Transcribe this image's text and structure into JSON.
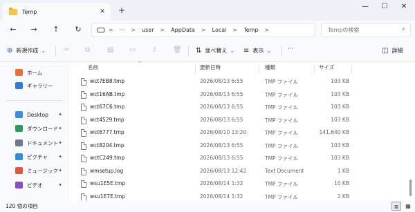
{
  "tab": {
    "title": "Temp",
    "close": "✕",
    "new_tab": "+"
  },
  "window": {
    "minimize": "—",
    "maximize": "☐",
    "close": "✕"
  },
  "nav": {
    "back": "←",
    "forward": "→",
    "up": "↑",
    "refresh": "↻"
  },
  "address": {
    "more": "···",
    "crumbs": [
      "user",
      "AppData",
      "Local",
      "Temp"
    ],
    "sep": ">"
  },
  "search": {
    "placeholder": "Tempの検索",
    "icon": "⌕"
  },
  "toolbar": {
    "new_label": "新規作成",
    "sort_label": "並べ替え",
    "view_label": "表示",
    "more": "···",
    "details_label": "詳細",
    "chevron": "⌄"
  },
  "sidebar": {
    "items": [
      {
        "label": "ホーム",
        "color": "#e8703a",
        "pinned": false
      },
      {
        "label": "ギャラリー",
        "color": "#2f7bd6",
        "pinned": false
      },
      {
        "label": "Desktop",
        "color": "#3b8fe3",
        "pinned": true
      },
      {
        "label": "ダウンロード",
        "color": "#2a9d5c",
        "pinned": true
      },
      {
        "label": "ドキュメント",
        "color": "#6b7a8c",
        "pinned": true
      },
      {
        "label": "ピクチャ",
        "color": "#2f8de0",
        "pinned": true
      },
      {
        "label": "ミュージック",
        "color": "#e0573d",
        "pinned": true
      },
      {
        "label": "ビデオ",
        "color": "#8b4dc7",
        "pinned": true
      }
    ],
    "pin_glyph": "📌"
  },
  "columns": {
    "name": "名前",
    "modified": "更新日時",
    "type": "種類",
    "size": "サイズ",
    "sort_arrow": "^"
  },
  "files": [
    {
      "name": "wct7EB8.tmp",
      "modified": "2026/08/13 6:55",
      "type": "TMP ファイル",
      "size": "103 KB"
    },
    {
      "name": "wct16AB.tmp",
      "modified": "2026/08/13 6:55",
      "type": "TMP ファイル",
      "size": "103 KB"
    },
    {
      "name": "wct67C6.tmp",
      "modified": "2026/08/13 6:55",
      "type": "TMP ファイル",
      "size": "103 KB"
    },
    {
      "name": "wct4529.tmp",
      "modified": "2026/08/13 6:55",
      "type": "TMP ファイル",
      "size": "103 KB"
    },
    {
      "name": "wct6777.tmp",
      "modified": "2026/08/10 13:20",
      "type": "TMP ファイル",
      "size": "141,640 KB"
    },
    {
      "name": "wct8204.tmp",
      "modified": "2026/08/13 6:55",
      "type": "TMP ファイル",
      "size": "103 KB"
    },
    {
      "name": "wctC249.tmp",
      "modified": "2026/08/13 6:55",
      "type": "TMP ファイル",
      "size": "103 KB"
    },
    {
      "name": "wmsetup.log",
      "modified": "2026/08/13 12:42",
      "type": "Text Document",
      "size": "1 KB"
    },
    {
      "name": "wsu1E5E.tmp",
      "modified": "2026/08/14 1:32",
      "type": "TMP ファイル",
      "size": "10 KB"
    },
    {
      "name": "wsu1E7E.tmp",
      "modified": "2026/08/14 1:32",
      "type": "TMP ファイル",
      "size": "2 KB"
    }
  ],
  "status": {
    "count": "120 個の項目"
  },
  "colors": {
    "accent": "#1e58b0",
    "folder": "#f5c446"
  }
}
